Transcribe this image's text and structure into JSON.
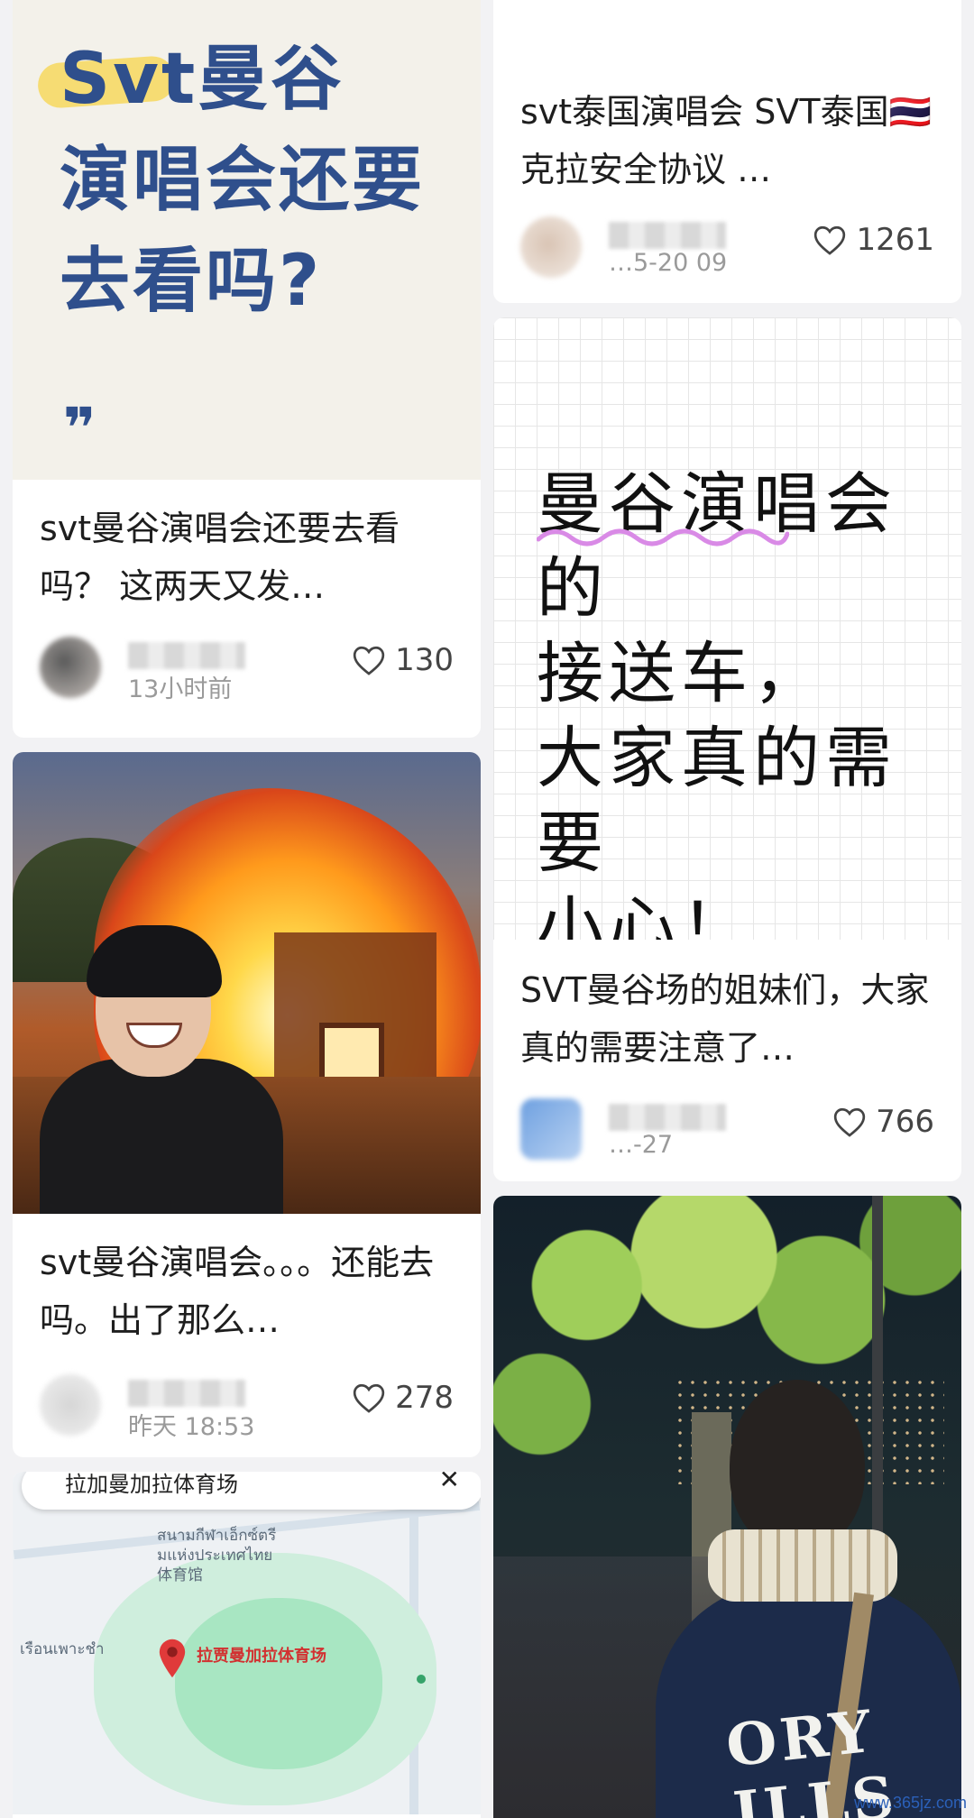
{
  "feed": {
    "left": [
      {
        "cover_text_lines": [
          "Svt曼谷",
          "演唱会还要",
          "去看吗?"
        ],
        "cover_quote": "❞",
        "title": "svt曼谷演唱会还要去看吗？ 这两天又发…",
        "time": "13小时前",
        "likes": "130"
      },
      {
        "title": "svt曼谷演唱会。。。还能去吗。出了那么…",
        "time": "昨天 18:53",
        "likes": "278"
      },
      {
        "map": {
          "search_text": "拉加曼加拉体育场",
          "close": "✕",
          "label_thai_1": "สนามกีฬาเอ็กซ์ตรี",
          "label_thai_2": "มแห่งประเทศไทย",
          "label_cn_small": "体育馆",
          "label_thai_left": "เรือนเพาะชำ",
          "venue_label": "拉贾曼加拉体育场"
        }
      }
    ],
    "right": [
      {
        "title": "svt泰国演唱会 SVT泰国🇹🇭 克拉安全协议 …",
        "time": "…5-20 09",
        "likes": "1261"
      },
      {
        "cover_text_lines": [
          "曼谷演唱会的",
          "接送车，",
          "大家真的需要",
          "小心！"
        ],
        "title": "SVT曼谷场的姐妹们，大家真的需要注意了…",
        "time": "…-27",
        "likes": "766"
      },
      {
        "jacket_text": "ORY ILLS"
      }
    ]
  },
  "watermark": "www.365jz.com",
  "colors": {
    "accent_blue": "#2f4f8c",
    "highlight_yellow": "#f6dc73",
    "wave_pink": "#d98ae6"
  }
}
